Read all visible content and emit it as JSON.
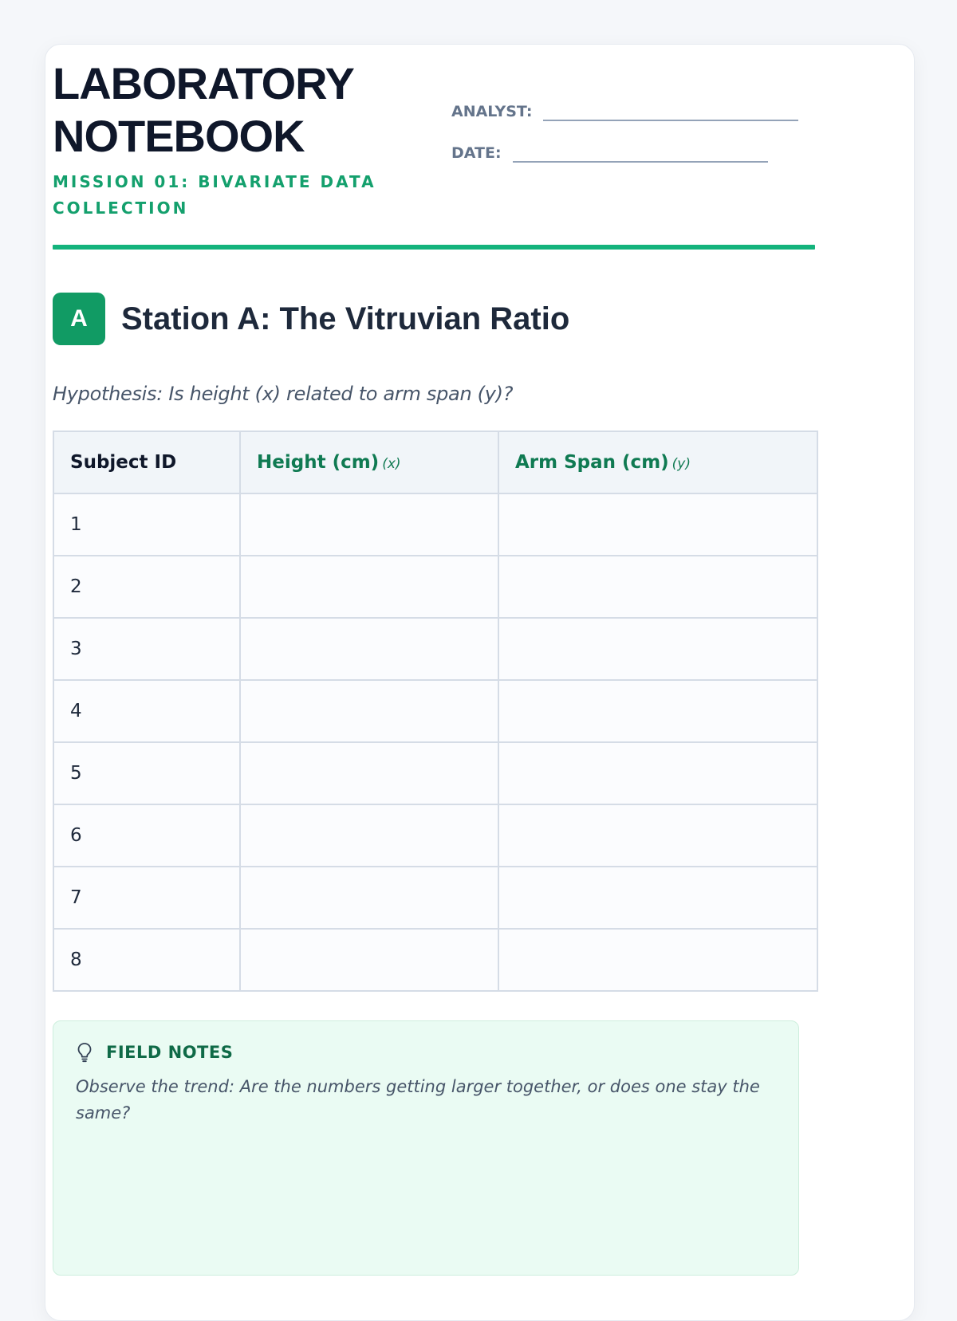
{
  "header": {
    "title": "LABORATORY\nNOTEBOOK",
    "mission": "MISSION 01: BIVARIATE DATA COLLECTION",
    "analyst_label": "ANALYST:",
    "date_label": "DATE:"
  },
  "station": {
    "badge": "A",
    "title": "Station A: The Vitruvian Ratio",
    "hypothesis": "Hypothesis: Is height (x) related to arm span (y)?"
  },
  "table": {
    "headers": {
      "id": "Subject ID",
      "height": "Height (cm)",
      "height_var": "(x)",
      "span": "Arm Span (cm)",
      "span_var": "(y)"
    },
    "rows": [
      "1",
      "2",
      "3",
      "4",
      "5",
      "6",
      "7",
      "8"
    ]
  },
  "notes": {
    "icon": "lightbulb-icon",
    "title": "FIELD NOTES",
    "text": "Observe the trend: Are the numbers getting larger together, or does one stay the same?"
  },
  "colors": {
    "accent": "#13b37c",
    "badge": "#119b64",
    "notes_bg": "#eafbf3"
  }
}
